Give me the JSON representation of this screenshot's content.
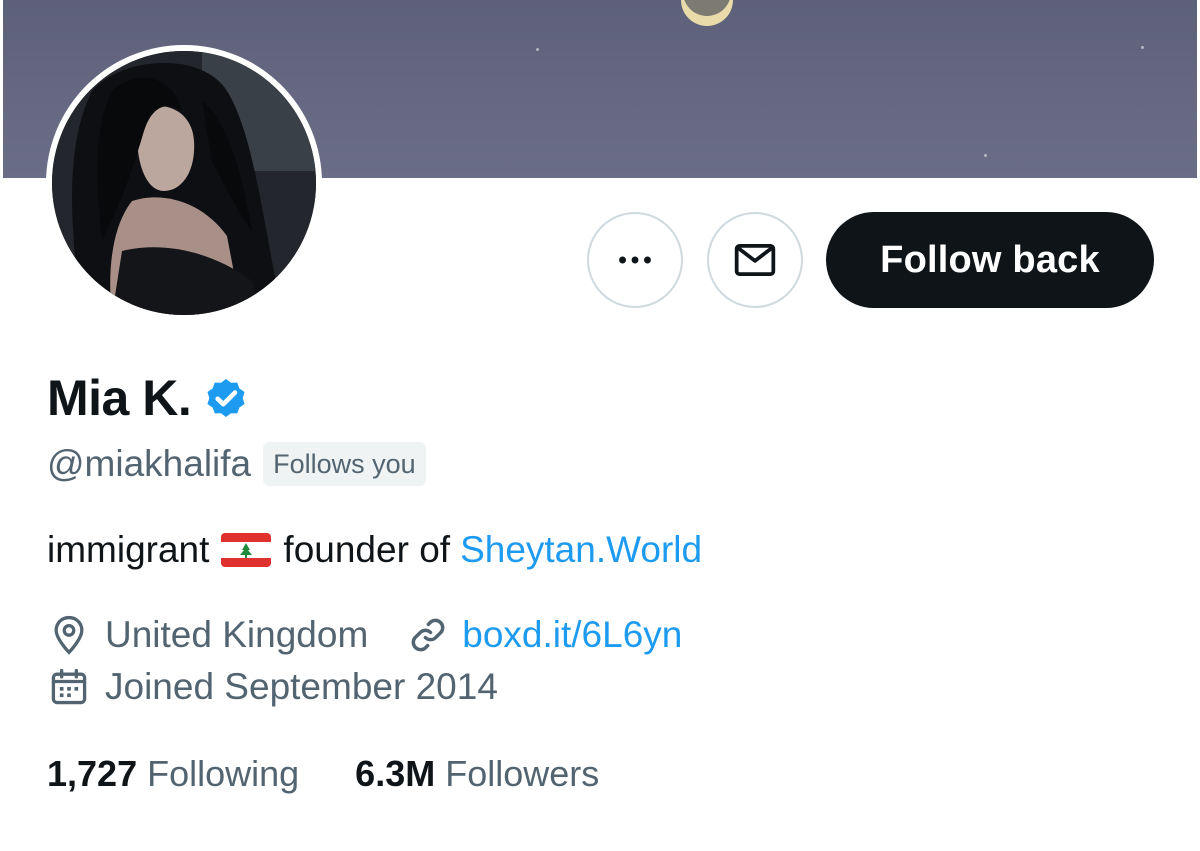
{
  "profile": {
    "display_name": "Mia K.",
    "verified": true,
    "handle": "@miakhalifa",
    "follows_you_label": "Follows you",
    "bio": {
      "text_before_flag": "immigrant",
      "flag_icon": "lebanon-flag-icon",
      "text_after_flag": "founder of",
      "link_text": "Sheytan.World"
    },
    "location": "United Kingdom",
    "website": "boxd.it/6L6yn",
    "joined": "Joined September 2014"
  },
  "actions": {
    "more_icon": "more-horizontal-icon",
    "message_icon": "envelope-icon",
    "follow_back_label": "Follow back"
  },
  "stats": {
    "following_count": "1,727",
    "following_label": "Following",
    "followers_count": "6.3M",
    "followers_label": "Followers"
  },
  "colors": {
    "text_primary": "#0f1419",
    "text_secondary": "#536471",
    "link": "#1d9bf0",
    "verified_badge": "#1d9bf0",
    "button_dark": "#0f1419",
    "border": "#cfd9de",
    "badge_bg": "#eff3f4"
  }
}
